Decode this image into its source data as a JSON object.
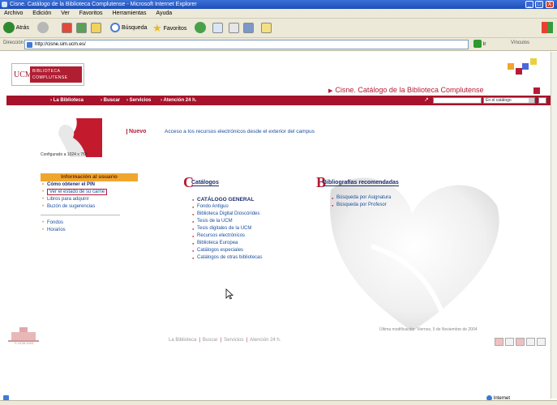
{
  "window": {
    "title": "Cisne. Catálogo de la Biblioteca Complutense - Microsoft Internet Explorer",
    "minimize": "_",
    "maximize": "□",
    "close": "X"
  },
  "menu": [
    "Archivo",
    "Edición",
    "Ver",
    "Favoritos",
    "Herramientas",
    "Ayuda"
  ],
  "toolbar": {
    "back": "Atrás",
    "search": "Búsqueda",
    "favorites": "Favoritos"
  },
  "address": {
    "label": "Dirección",
    "url": "http://cisne.sim.ucm.es/",
    "go": "Ir",
    "links": "Vínculos"
  },
  "header": {
    "logo_u": "UCM",
    "logo_line1": "BIBLIOTECA",
    "logo_line2": "COMPLUTENSE",
    "tagline": "Cisne. Catálogo de la Biblioteca Complutense"
  },
  "nav": {
    "items": [
      "La Biblioteca",
      "Buscar",
      "Servicios",
      "Atención 24 h."
    ],
    "search_scope": "En el catálogo"
  },
  "emblem_caption": "Configurado a 1024 x 768",
  "news": {
    "badge": "Nuevo",
    "text": "Acceso a los recursos electrónicos desde el exterior del campus"
  },
  "user_info": {
    "header": "Información al usuario",
    "items": [
      "Cómo obtener el PIN",
      "Ver el estado de su carné",
      "Libros para adquirir",
      "Buzón de sugerencias"
    ],
    "items2": [
      "Fondos",
      "Horarios"
    ]
  },
  "catalogs": {
    "title": "Catálogos",
    "items": [
      "CATÁLOGO GENERAL",
      "Fondo Antiguo",
      "Biblioteca Digital Dioscórides",
      "Tesis de la UCM",
      "Tesis digitales de la UCM",
      "Recursos electrónicos",
      "Biblioteca Europea",
      "Catálogos especiales",
      "Catálogos de otras bibliotecas"
    ]
  },
  "bibliographies": {
    "title": "Bibliografías recomendadas",
    "items": [
      "Búsqueda por Asignatura",
      "Búsqueda por Profesor"
    ]
  },
  "footer": {
    "modified": "Última modificación: Viernes, 5 de Noviembre de 2004",
    "links": [
      "La Biblioteca",
      "Buscar",
      "Servicios",
      "Atención 24 h."
    ],
    "copyright": "© UCM 2003"
  },
  "status": {
    "zone": "Internet"
  },
  "colors": {
    "brand_red": "#a6132a",
    "accent_orange": "#f0a62e",
    "link_blue": "#1a4d9c"
  }
}
